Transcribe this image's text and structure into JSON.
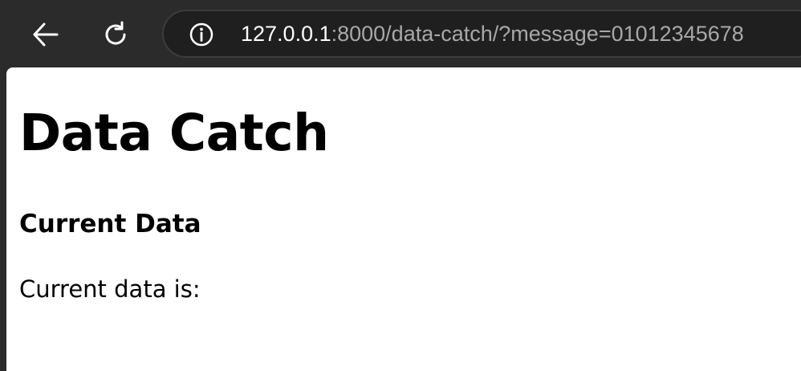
{
  "browser": {
    "url_host": "127.0.0.1",
    "url_rest": ":8000/data-catch/?message=01012345678"
  },
  "page": {
    "title": "Data Catch",
    "section_heading": "Current Data",
    "data_label": "Current data is:"
  },
  "icons": {
    "back": "back-arrow-icon",
    "reload": "reload-icon",
    "info": "info-icon"
  },
  "colors": {
    "chrome_bg": "#2b2b2b",
    "omnibox_bg": "#1f1f1f",
    "url_host": "#ffffff",
    "url_rest": "#a8a8a8",
    "page_bg": "#ffffff"
  }
}
